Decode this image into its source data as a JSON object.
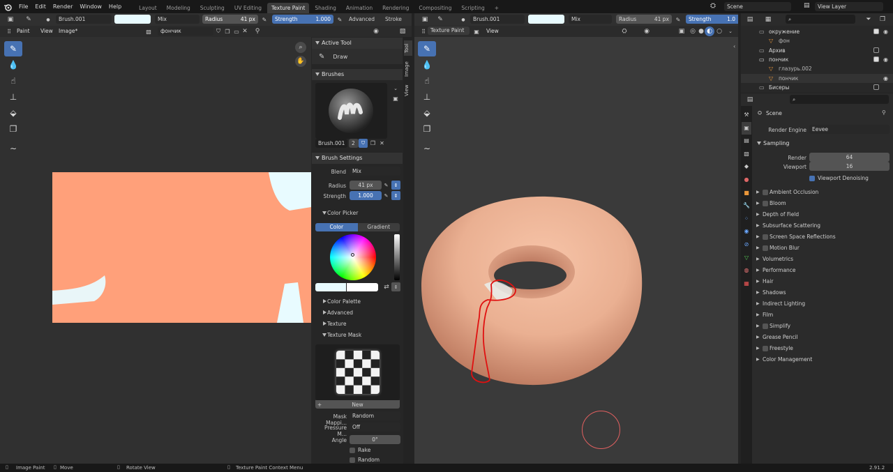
{
  "menu": {
    "items": [
      "File",
      "Edit",
      "Render",
      "Window",
      "Help"
    ]
  },
  "workspaces": {
    "tabs": [
      "Layout",
      "Modeling",
      "Sculpting",
      "UV Editing",
      "Texture Paint",
      "Shading",
      "Animation",
      "Rendering",
      "Compositing",
      "Scripting"
    ],
    "active_index": 4,
    "add_label": "+"
  },
  "scene": {
    "name": "Scene",
    "view_layer": "View Layer"
  },
  "image_editor": {
    "brush_name": "Brush.001",
    "blend": "Mix",
    "radius_label": "Radius",
    "radius_value": "41 px",
    "strength_label": "Strength",
    "strength_value": "1.000",
    "advanced_label": "Advanced",
    "stroke_label": "Stroke",
    "mode_label": "Paint",
    "view_label": "View",
    "image_label": "Image*",
    "image_name": "фончик"
  },
  "sidebar": {
    "tabs": [
      "Tool",
      "Image",
      "View"
    ],
    "active_tool_title": "Active Tool",
    "active_tool_name": "Draw",
    "brushes_title": "Brushes",
    "brush_name": "Brush.001",
    "brush_users": "2",
    "brush_settings_title": "Brush Settings",
    "blend_label": "Blend",
    "blend_value": "Mix",
    "radius_label": "Radius",
    "radius_value": "41 px",
    "strength_label": "Strength",
    "strength_value": "1.000",
    "color_picker_title": "Color Picker",
    "color_tab": "Color",
    "gradient_tab": "Gradient",
    "color_palette": "Color Palette",
    "advanced": "Advanced",
    "texture": "Texture",
    "texture_mask": "Texture Mask",
    "new_label": "New",
    "mask_mapping_label": "Mask Mappi...",
    "mask_mapping_value": "Random",
    "pressure_label": "Pressure M...",
    "pressure_value": "Off",
    "angle_label": "Angle",
    "angle_value": "0°",
    "rake_label": "Rake",
    "random_label": "Random"
  },
  "viewport": {
    "brush_name": "Brush.001",
    "blend": "Mix",
    "radius_label": "Radius",
    "radius_value": "41 px",
    "strength_label": "Strength",
    "strength_value": "1.0",
    "mode_label": "Texture Paint",
    "view_label": "View"
  },
  "outliner": {
    "search_placeholder": "",
    "rows": [
      {
        "name": "окружение",
        "indent": 0,
        "checked": true
      },
      {
        "name": "фон",
        "indent": 1,
        "checked": false
      },
      {
        "name": "Архив",
        "indent": 0,
        "checked": false
      },
      {
        "name": "пончик",
        "indent": 0,
        "checked": true
      },
      {
        "name": "глазурь.002",
        "indent": 1,
        "checked": false
      },
      {
        "name": "пончик",
        "indent": 1,
        "checked": false
      },
      {
        "name": "Бисеры",
        "indent": 0,
        "checked": false
      }
    ]
  },
  "properties": {
    "scene_label": "Scene",
    "render_engine_label": "Render Engine",
    "render_engine_value": "Eevee",
    "sampling_title": "Sampling",
    "render_label": "Render",
    "render_value": "64",
    "viewport_label": "Viewport",
    "viewport_value": "16",
    "viewport_denoising": "Viewport Denoising",
    "sections": [
      {
        "label": "Ambient Occlusion",
        "checkbox": true
      },
      {
        "label": "Bloom",
        "checkbox": true
      },
      {
        "label": "Depth of Field",
        "checkbox": false
      },
      {
        "label": "Subsurface Scattering",
        "checkbox": false
      },
      {
        "label": "Screen Space Reflections",
        "checkbox": true
      },
      {
        "label": "Motion Blur",
        "checkbox": true
      },
      {
        "label": "Volumetrics",
        "checkbox": false
      },
      {
        "label": "Performance",
        "checkbox": false
      },
      {
        "label": "Hair",
        "checkbox": false
      },
      {
        "label": "Shadows",
        "checkbox": false
      },
      {
        "label": "Indirect Lighting",
        "checkbox": false
      },
      {
        "label": "Film",
        "checkbox": false
      },
      {
        "label": "Simplify",
        "checkbox": true
      },
      {
        "label": "Grease Pencil",
        "checkbox": false
      },
      {
        "label": "Freestyle",
        "checkbox": true
      },
      {
        "label": "Color Management",
        "checkbox": false
      }
    ]
  },
  "status_bar": {
    "image_paint": "Image Paint",
    "move": "Move",
    "rotate_view": "Rotate View",
    "context_menu": "Texture Paint Context Menu",
    "version": "2.91.2"
  },
  "colors": {
    "accent": "#4772b3",
    "texture_fill": "#ffa07a",
    "brush_color": "#e8fbff",
    "donut_outline": "#e01010"
  }
}
